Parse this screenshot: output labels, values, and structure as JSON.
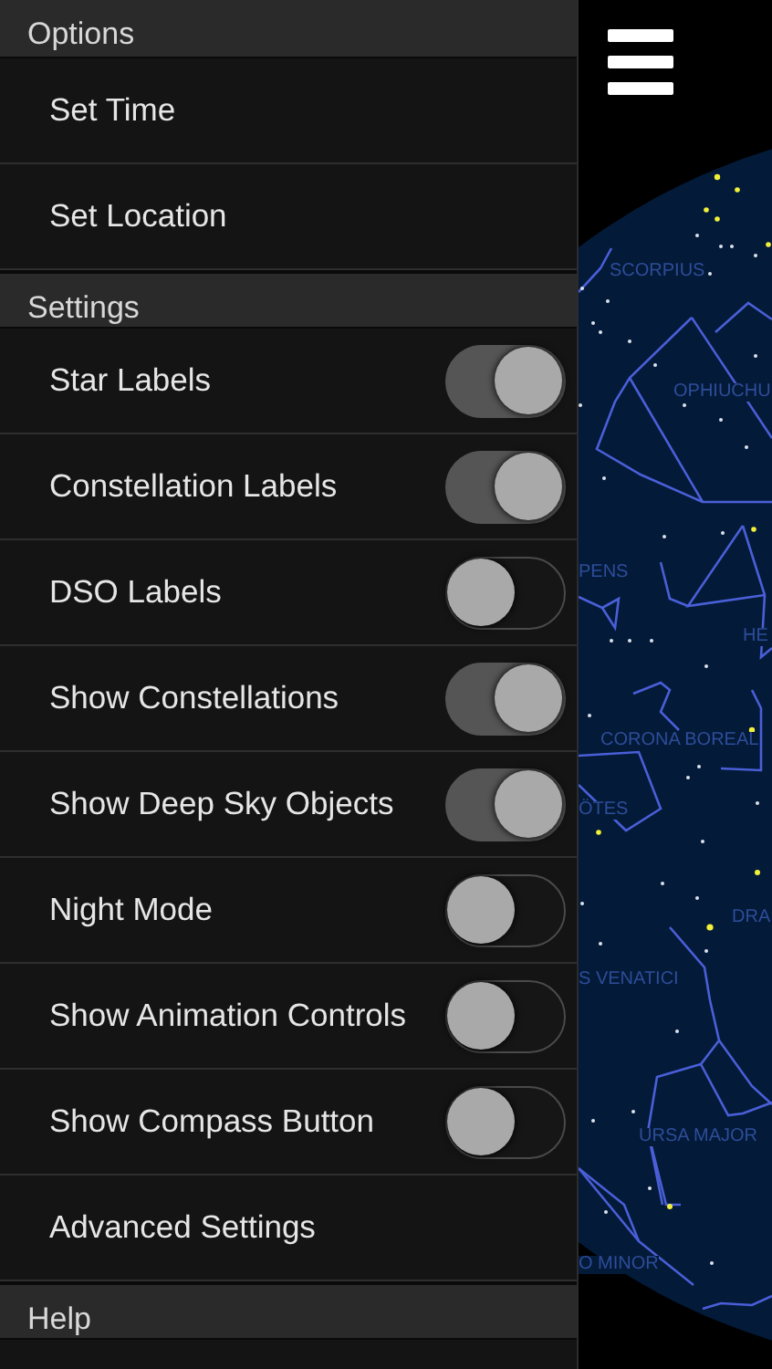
{
  "menu": {
    "sections": [
      {
        "title": "Options",
        "items": [
          {
            "kind": "link",
            "label": "Set Time"
          },
          {
            "kind": "link",
            "label": "Set Location"
          }
        ]
      },
      {
        "title": "Settings",
        "items": [
          {
            "kind": "toggle",
            "label": "Star Labels",
            "on": true
          },
          {
            "kind": "toggle",
            "label": "Constellation Labels",
            "on": true
          },
          {
            "kind": "toggle",
            "label": "DSO Labels",
            "on": false
          },
          {
            "kind": "toggle",
            "label": "Show Constellations",
            "on": true
          },
          {
            "kind": "toggle",
            "label": "Show Deep Sky Objects",
            "on": true
          },
          {
            "kind": "toggle",
            "label": "Night Mode",
            "on": false
          },
          {
            "kind": "toggle",
            "label": "Show Animation Controls",
            "on": false
          },
          {
            "kind": "toggle",
            "label": "Show Compass Button",
            "on": false
          },
          {
            "kind": "link",
            "label": "Advanced Settings"
          }
        ]
      },
      {
        "title": "Help"
      }
    ]
  },
  "sky_map": {
    "labels": [
      "SCORPIUS",
      "OPHIUCHU",
      "PENS",
      "HE",
      "CORONA BOREAL",
      "ÖTES",
      "DRA",
      "S VENATICI",
      "URSA MAJOR",
      "O MINOR"
    ]
  }
}
